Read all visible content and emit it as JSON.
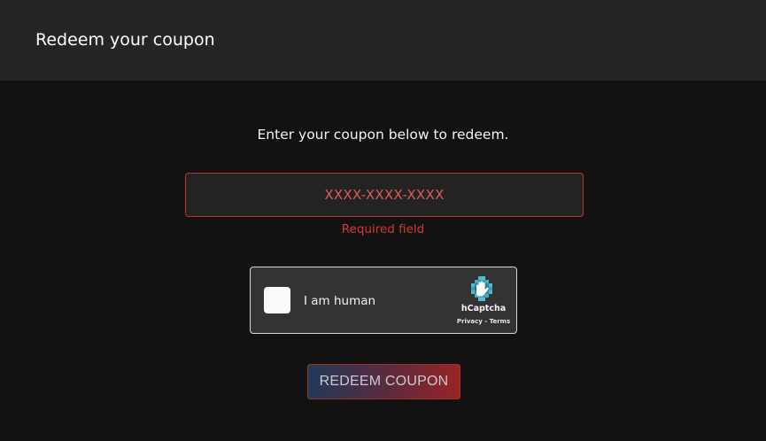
{
  "header": {
    "title": "Redeem your coupon"
  },
  "main": {
    "instruction": "Enter your coupon below to redeem.",
    "coupon_input": {
      "placeholder": "XXXX-XXXX-XXXX",
      "value": ""
    },
    "error": "Required field",
    "captcha": {
      "label": "I am human",
      "brand": "hCaptcha",
      "privacy_link": "Privacy",
      "separator": " - ",
      "terms_link": "Terms",
      "logo_icon": "hcaptcha-logo-icon"
    },
    "redeem_button": "REDEEM COUPON"
  },
  "colors": {
    "background": "#121212",
    "header": "#252525",
    "error": "#d23a30",
    "input_border": "#c0312e"
  }
}
